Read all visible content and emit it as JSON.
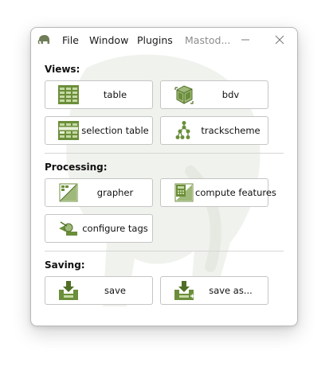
{
  "menu": {
    "file": "File",
    "window": "Window",
    "plugins": "Plugins",
    "title": "Mastod..."
  },
  "sections": {
    "views": "Views:",
    "processing": "Processing:",
    "saving": "Saving:"
  },
  "buttons": {
    "table": "table",
    "bdv": "bdv",
    "selection_table": "selection table",
    "trackscheme": "trackscheme",
    "grapher": "grapher",
    "compute_features": "compute features",
    "configure_tags": "configure tags",
    "save": "save",
    "save_as": "save as..."
  },
  "icons": {
    "app": "mastodon-logo-icon",
    "table": "table-icon",
    "bdv": "bdv-cube-icon",
    "selection_table": "selection-table-icon",
    "trackscheme": "trackscheme-icon",
    "grapher": "grapher-icon",
    "compute_features": "compute-features-icon",
    "configure_tags": "configure-tags-icon",
    "save": "save-icon",
    "save_as": "save-as-icon"
  },
  "colors": {
    "icon_green": "#6b8e3a",
    "icon_dark": "#4f6e25",
    "icon_light": "#c6d9a4",
    "watermark": "#eef1ea"
  }
}
